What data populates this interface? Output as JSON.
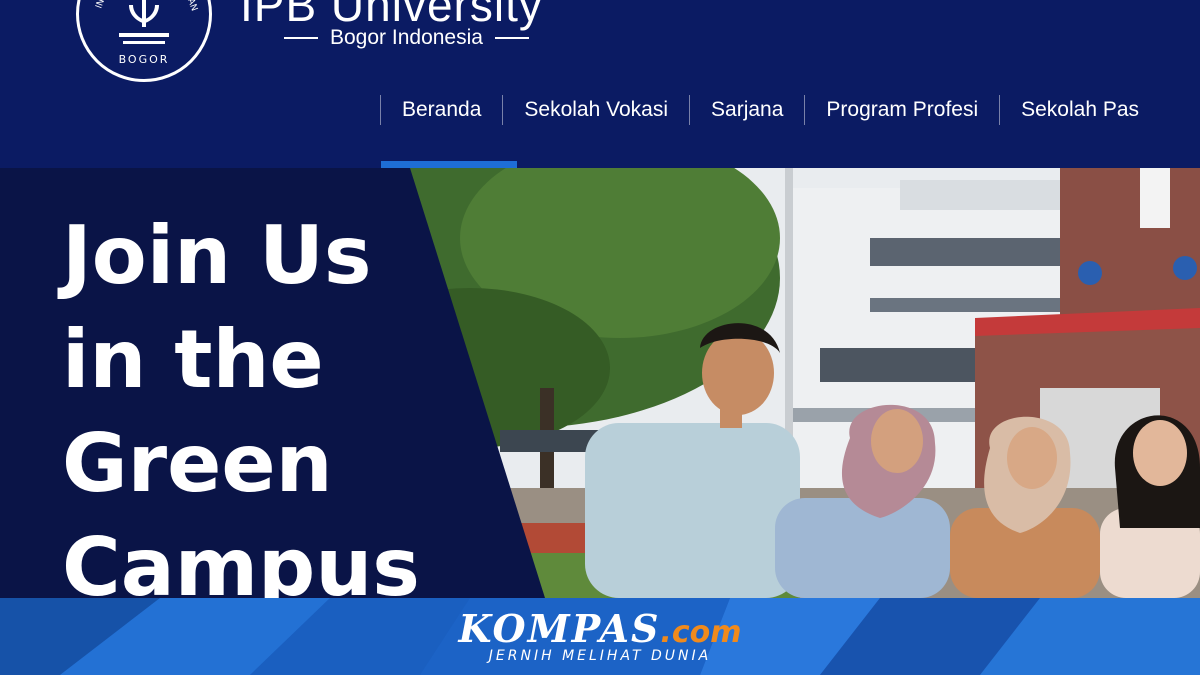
{
  "header": {
    "brand_title": "IPB University",
    "brand_subtitle": "Bogor Indonesia",
    "logo_ring_text": "INSTITUT PERTANIAN",
    "logo_bottom_text": "BOGOR",
    "nav": [
      {
        "label": "Beranda",
        "active": true
      },
      {
        "label": "Sekolah Vokasi",
        "active": false
      },
      {
        "label": "Sarjana",
        "active": false
      },
      {
        "label": "Program Profesi",
        "active": false
      },
      {
        "label": "Sekolah Pas",
        "active": false
      }
    ]
  },
  "hero": {
    "headline_lines": [
      "Join Us",
      "in the",
      "Green",
      "Campus"
    ]
  },
  "footer": {
    "brand": "KOMPAS",
    "brand_suffix": ".com",
    "tagline": "JERNIH MELIHAT DUNIA"
  },
  "colors": {
    "header_bg": "#0b1b63",
    "hero_panel": "#0a1447",
    "active_underline": "#1e6ed6",
    "footer_bg": "#1a62c4",
    "kompas_accent": "#f08a1c"
  },
  "icons": {
    "logo": "ipb-emblem-icon"
  }
}
